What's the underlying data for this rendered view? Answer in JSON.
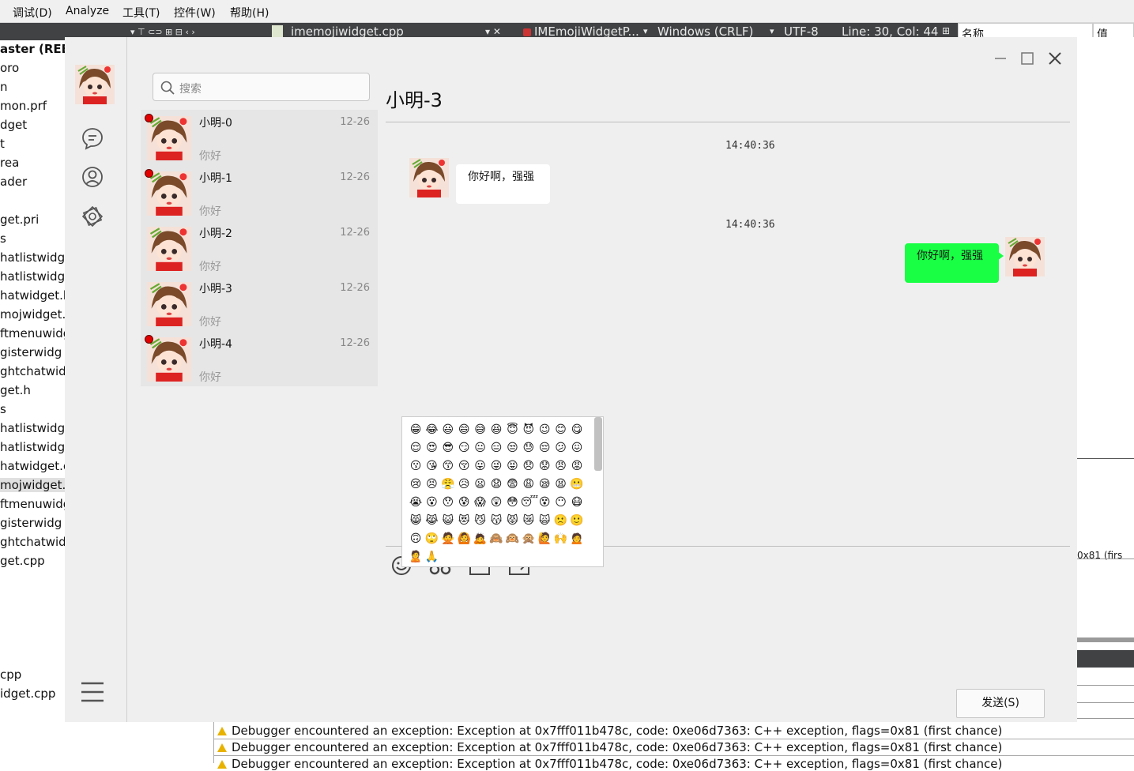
{
  "ide": {
    "menus": [
      "调试(D)",
      "Analyze",
      "工具(T)",
      "控件(W)",
      "帮助(H)"
    ],
    "file_tab": "imemojiwidget.cpp",
    "class_tab": "IMEmojiWidgetP...",
    "line_endings": "Windows (CRLF)",
    "encoding": "UTF-8",
    "cursor_pos": "Line: 30, Col: 44",
    "props_name_header": "名称",
    "props_value_header": "值",
    "side_value": "0x81 (firs",
    "project_files": [
      "aster (REBA",
      "oro",
      "n",
      "mon.prf",
      "dget",
      "t",
      "rea",
      "ader",
      "",
      "get.pri",
      "s",
      "hatlistwidge",
      "hatlistwidge",
      "hatwidget.h",
      "mojwidget.h",
      "ftmenuwidg",
      "gisterwidg",
      "ghtchatwidg",
      "get.h",
      "s",
      "hatlistwidge",
      "hatlistwidge",
      "hatwidget.c",
      "mojwidget.c",
      "ftmenuwidg",
      "gisterwidg",
      "ghtchatwidg",
      "get.cpp",
      "",
      "",
      "",
      "",
      "",
      "cpp",
      "idget.cpp"
    ],
    "log": [
      "Debugger encountered an exception: Exception at 0x7fff011b478c, code: 0xe06d7363: C++ exception, flags=0x81 (first chance)",
      "Debugger encountered an exception: Exception at 0x7fff011b478c, code: 0xe06d7363: C++ exception, flags=0x81 (first chance)",
      "Debugger encountered an exception: Exception at 0x7fff011b478c, code: 0xe06d7363: C++ exception, flags=0x81 (first chance)"
    ]
  },
  "chat": {
    "search_placeholder": "搜索",
    "contacts": [
      {
        "name": "小明-0",
        "date": "12-26",
        "preview": "你好",
        "unread": true
      },
      {
        "name": "小明-1",
        "date": "12-26",
        "preview": "你好",
        "unread": true
      },
      {
        "name": "小明-2",
        "date": "12-26",
        "preview": "你好",
        "unread": false
      },
      {
        "name": "小明-3",
        "date": "12-26",
        "preview": "你好",
        "unread": false
      },
      {
        "name": "小明-4",
        "date": "12-26",
        "preview": "你好",
        "unread": true
      }
    ],
    "title": "小明-3",
    "messages": [
      {
        "time": "14:40:36",
        "text": "你好啊，强强",
        "side": "left"
      },
      {
        "time": "14:40:36",
        "text": "你好啊，强强",
        "side": "right"
      }
    ],
    "send_label": "发送(S)",
    "colors": {
      "accent": "#18ff44",
      "unread": "#e00000",
      "window": "#efefef"
    },
    "emojis": "😁😂😃😄😅😆😇😈😉😊😋😌😍😎😏😐😑😒😓😔😕😖😗😘😙😚😛😜😝😞😟😠😡😢😣😤😥😦😧😨😩😪😫😬😭😮😯😰😱😲😳😴😵😶😷😸😹😺😻😼😽😾😿🙀🙁🙂🙃🙄🙅🙆🙇🙈🙉🙊🙋🙌🙍🙎🙏"
  }
}
